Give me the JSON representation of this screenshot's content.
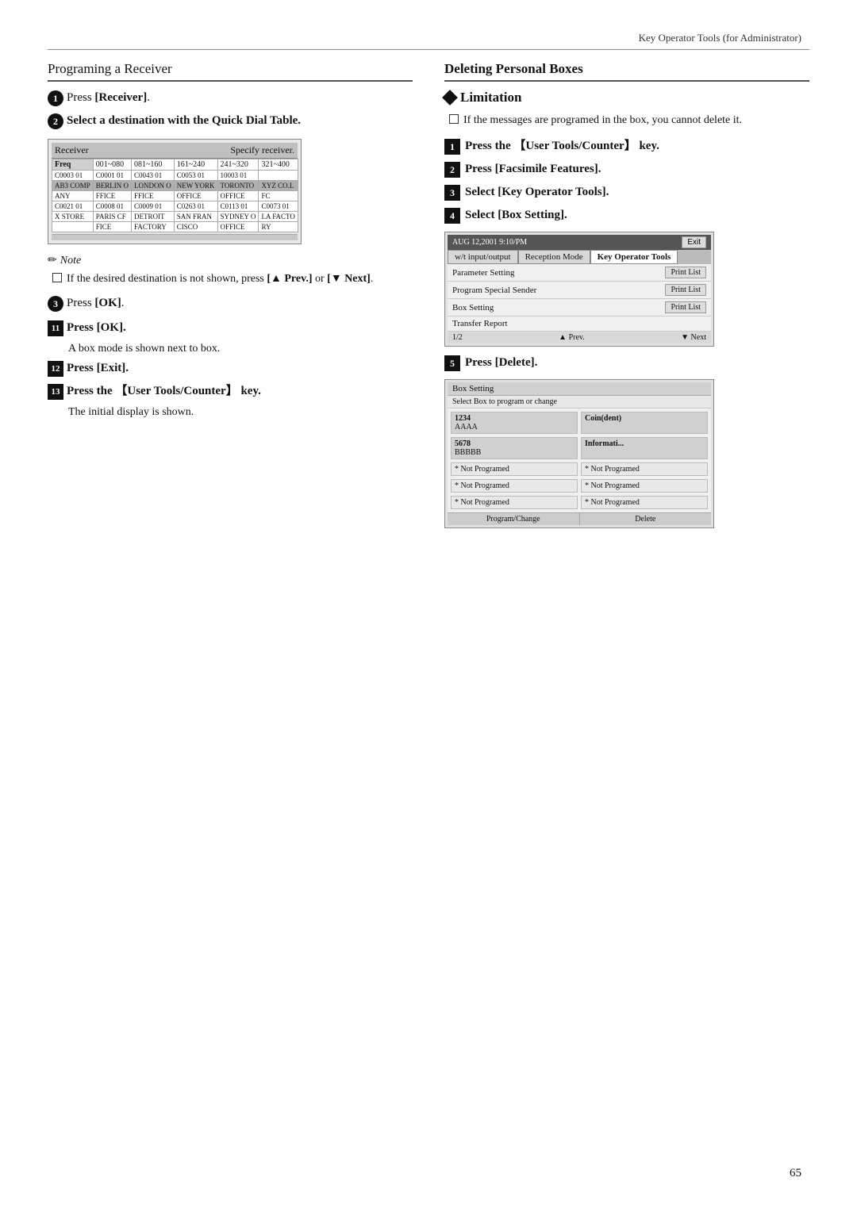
{
  "header": {
    "right_label": "Key Operator Tools (for Administrator)"
  },
  "left_col": {
    "section_title": "Programing a Receiver",
    "step1": {
      "num": "1",
      "text_bold": "Press [Receiver]."
    },
    "step2": {
      "num": "2",
      "text_bold": "Select a destination with the Quick Dial Table."
    },
    "screen": {
      "header_left": "Receiver",
      "header_right": "Specify receiver.",
      "freq_label": "Freq",
      "cols": [
        "001~080",
        "081~160",
        "161~240",
        "241~320",
        "321~400"
      ],
      "row1": [
        "AB3 COMP",
        "BERLIN O",
        "LONDON O",
        "NEW YORK",
        "TORONTO",
        "XYZ CO.L"
      ],
      "row1_prefix": [
        "C0003",
        "01",
        "C0001",
        "01",
        "C0043",
        "01",
        "C0053",
        "01",
        "10003",
        "01"
      ],
      "row1_extra": "ANY  FFICE   FFICE    OFFICE   OFFICE   FC",
      "row2": [
        "X STORE",
        "PARIS CF",
        "DETROIT",
        "SAN FRAN",
        "SYDNEY O",
        "LA FACTO"
      ],
      "row2_prefix": [
        "C0021",
        "01",
        "C0008",
        "01",
        "C0009",
        "01",
        "C0263",
        "01",
        "C0113",
        "01",
        "C0073",
        "01"
      ],
      "row2_extra": "           FICE      FACTORY   CISCO     OFFICE   RY"
    },
    "note_title": "Note",
    "note_text": "If the desired destination is not shown, press [▲ Prev.] or [▼ Next].",
    "step3_circle": "❸",
    "step3_text": "Press [OK].",
    "step11": {
      "num": "11",
      "text": "Press [OK]."
    },
    "step11_sub": "A box mode is shown next to box.",
    "step12": {
      "num": "12",
      "text": "Press [Exit]."
    },
    "step13": {
      "num": "13",
      "text": "Press the 【User Tools/Counter】 key."
    },
    "step13_sub": "The initial display is shown."
  },
  "right_col": {
    "section_title": "Deleting Personal Boxes",
    "limitation_title": "Limitation",
    "limitation_text": "If the messages are programed in the box, you cannot delete it.",
    "step1": {
      "num": "1",
      "text": "Press the 【User Tools/Counter】 key."
    },
    "step2": {
      "num": "2",
      "text": "Press [Facsimile Features]."
    },
    "step3": {
      "num": "3",
      "text": "Select [Key Operator Tools]."
    },
    "step4": {
      "num": "4",
      "text": "Select [Box Setting]."
    },
    "screen1": {
      "date": "AUG 12,2001 9:10/PM",
      "exit_btn": "Exit",
      "tabs": [
        "w/t input/output",
        "Reception Mode",
        "Key Operator Tools"
      ],
      "rows": [
        {
          "label": "Parameter Setting",
          "btn": "Print List"
        },
        {
          "label": "Program Special Sender",
          "btn": "Print List"
        },
        {
          "label": "Box Setting",
          "btn": "Print List"
        },
        {
          "label": "Transfer Report",
          "btn": ""
        }
      ],
      "footer": "1/2",
      "prev_btn": "▲ Prev.",
      "next_btn": "▼ Next"
    },
    "step5": {
      "num": "5",
      "text": "Press [Delete]."
    },
    "screen2": {
      "header": "Box Setting",
      "subheader": "Select Box to program or change",
      "col_headers": [
        "1234\nAAAA",
        "Coin(dent)",
        "5678\nBBBBB",
        "Informati..."
      ],
      "not_programed_cells": [
        "* Not Programed",
        "* Not Programed",
        "* Not Programed",
        "* Not Programed",
        "* Not Programed",
        "* Not Programed"
      ],
      "footer_btns": [
        "Program/Change",
        "Delete"
      ]
    }
  },
  "page_number": "65"
}
